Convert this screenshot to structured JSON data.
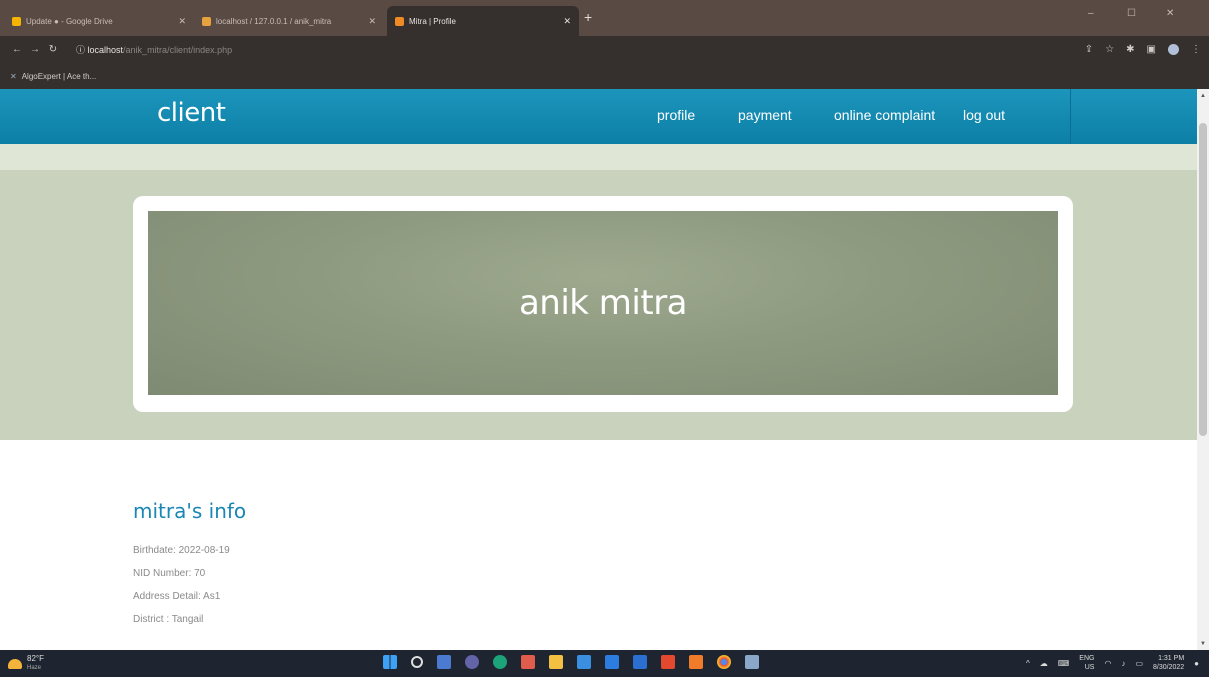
{
  "browser": {
    "tabs": [
      {
        "title": "Update ● - Google Drive",
        "favicon_color": "#f5b400"
      },
      {
        "title": "localhost / 127.0.0.1 / anik_mitra",
        "favicon_color": "#e6a23c"
      },
      {
        "title": "Mitra | Profile",
        "favicon_color": "#f08a24",
        "active": true
      }
    ],
    "new_tab": "+",
    "window_controls": {
      "minimize": "–",
      "maximize": "☐",
      "close": "✕"
    },
    "url_host": "localhost",
    "url_path": "/anik_mitra/client/index.php",
    "bookmark": "AlgoExpert | Ace th..."
  },
  "site": {
    "brand": "client",
    "nav": {
      "profile": "profile",
      "payment": "payment",
      "complaint": "online complaint",
      "logout": "log out"
    }
  },
  "hero": {
    "name": "anik mitra"
  },
  "info": {
    "title": "mitra's info",
    "lines": [
      "Birthdate: 2022-08-19",
      "NID Number: 70",
      "Address Detail: As1",
      "District : Tangail"
    ]
  },
  "taskbar": {
    "weather_temp": "82°F",
    "weather_desc": "Haze",
    "language": "ENG",
    "region": "US",
    "time": "1:31 PM",
    "date": "8/30/2022"
  },
  "colors": {
    "header": "#1589b1",
    "accent_title": "#1a86b5",
    "hero_bg": "#c9d2bd",
    "banner": "#8e9a80"
  }
}
